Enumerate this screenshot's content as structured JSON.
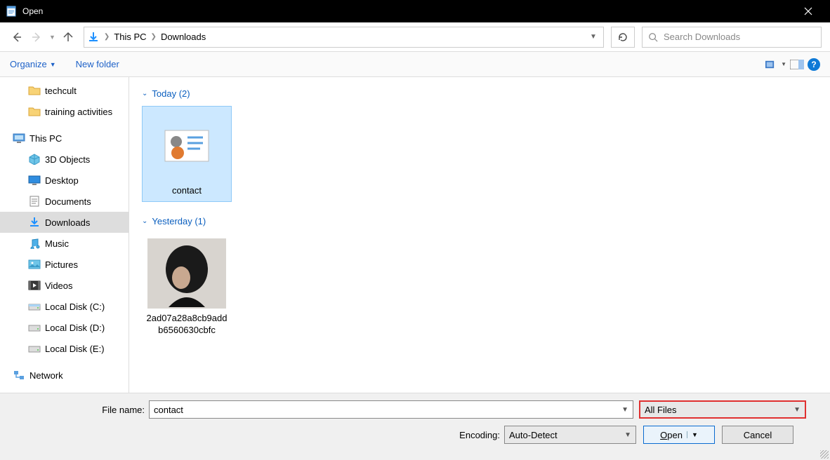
{
  "titlebar": {
    "title": "Open"
  },
  "nav": {
    "breadcrumb": {
      "root": "This PC",
      "current": "Downloads"
    },
    "search_placeholder": "Search Downloads"
  },
  "toolbar": {
    "organize_label": "Organize",
    "newfolder_label": "New folder"
  },
  "sidebar": {
    "quick": [
      {
        "label": "techcult",
        "icon": "folder"
      },
      {
        "label": "training activities",
        "icon": "folder"
      }
    ],
    "thispc_label": "This PC",
    "thispc": [
      {
        "label": "3D Objects",
        "icon": "cube"
      },
      {
        "label": "Desktop",
        "icon": "desktop"
      },
      {
        "label": "Documents",
        "icon": "document"
      },
      {
        "label": "Downloads",
        "icon": "download",
        "selected": true
      },
      {
        "label": "Music",
        "icon": "music"
      },
      {
        "label": "Pictures",
        "icon": "pictures"
      },
      {
        "label": "Videos",
        "icon": "videos"
      },
      {
        "label": "Local Disk (C:)",
        "icon": "disk"
      },
      {
        "label": "Local Disk (D:)",
        "icon": "disk"
      },
      {
        "label": "Local Disk (E:)",
        "icon": "disk"
      }
    ],
    "network_label": "Network"
  },
  "groups": [
    {
      "header": "Today (2)",
      "items": [
        {
          "name": "contact",
          "selected": true,
          "thumb": "contact"
        }
      ]
    },
    {
      "header": "Yesterday (1)",
      "items": [
        {
          "name": "2ad07a28a8cb9addb6560630cbfc",
          "selected": false,
          "thumb": "photo"
        }
      ]
    }
  ],
  "bottom": {
    "filename_label": "File name:",
    "filename_value": "contact",
    "filetype_value": "All Files",
    "encoding_label": "Encoding:",
    "encoding_value": "Auto-Detect",
    "open_label": "Open",
    "cancel_label": "Cancel"
  }
}
